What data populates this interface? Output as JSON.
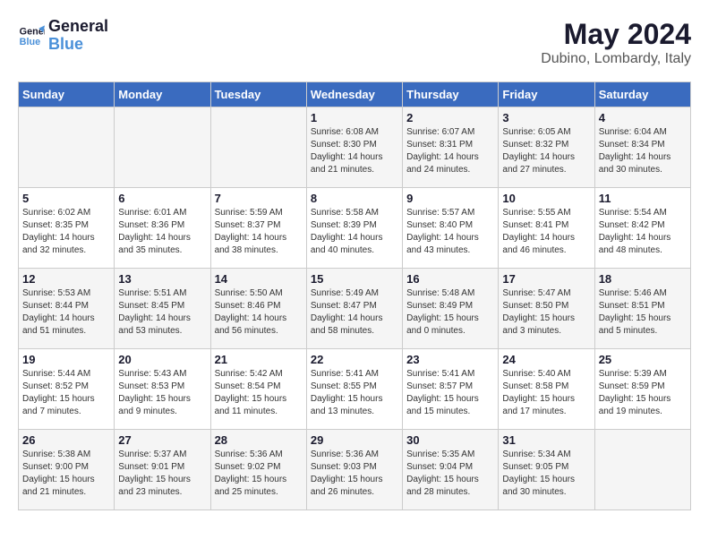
{
  "header": {
    "logo_line1": "General",
    "logo_line2": "Blue",
    "month_year": "May 2024",
    "location": "Dubino, Lombardy, Italy"
  },
  "days_of_week": [
    "Sunday",
    "Monday",
    "Tuesday",
    "Wednesday",
    "Thursday",
    "Friday",
    "Saturday"
  ],
  "weeks": [
    [
      {
        "day": "",
        "detail": ""
      },
      {
        "day": "",
        "detail": ""
      },
      {
        "day": "",
        "detail": ""
      },
      {
        "day": "1",
        "detail": "Sunrise: 6:08 AM\nSunset: 8:30 PM\nDaylight: 14 hours\nand 21 minutes."
      },
      {
        "day": "2",
        "detail": "Sunrise: 6:07 AM\nSunset: 8:31 PM\nDaylight: 14 hours\nand 24 minutes."
      },
      {
        "day": "3",
        "detail": "Sunrise: 6:05 AM\nSunset: 8:32 PM\nDaylight: 14 hours\nand 27 minutes."
      },
      {
        "day": "4",
        "detail": "Sunrise: 6:04 AM\nSunset: 8:34 PM\nDaylight: 14 hours\nand 30 minutes."
      }
    ],
    [
      {
        "day": "5",
        "detail": "Sunrise: 6:02 AM\nSunset: 8:35 PM\nDaylight: 14 hours\nand 32 minutes."
      },
      {
        "day": "6",
        "detail": "Sunrise: 6:01 AM\nSunset: 8:36 PM\nDaylight: 14 hours\nand 35 minutes."
      },
      {
        "day": "7",
        "detail": "Sunrise: 5:59 AM\nSunset: 8:37 PM\nDaylight: 14 hours\nand 38 minutes."
      },
      {
        "day": "8",
        "detail": "Sunrise: 5:58 AM\nSunset: 8:39 PM\nDaylight: 14 hours\nand 40 minutes."
      },
      {
        "day": "9",
        "detail": "Sunrise: 5:57 AM\nSunset: 8:40 PM\nDaylight: 14 hours\nand 43 minutes."
      },
      {
        "day": "10",
        "detail": "Sunrise: 5:55 AM\nSunset: 8:41 PM\nDaylight: 14 hours\nand 46 minutes."
      },
      {
        "day": "11",
        "detail": "Sunrise: 5:54 AM\nSunset: 8:42 PM\nDaylight: 14 hours\nand 48 minutes."
      }
    ],
    [
      {
        "day": "12",
        "detail": "Sunrise: 5:53 AM\nSunset: 8:44 PM\nDaylight: 14 hours\nand 51 minutes."
      },
      {
        "day": "13",
        "detail": "Sunrise: 5:51 AM\nSunset: 8:45 PM\nDaylight: 14 hours\nand 53 minutes."
      },
      {
        "day": "14",
        "detail": "Sunrise: 5:50 AM\nSunset: 8:46 PM\nDaylight: 14 hours\nand 56 minutes."
      },
      {
        "day": "15",
        "detail": "Sunrise: 5:49 AM\nSunset: 8:47 PM\nDaylight: 14 hours\nand 58 minutes."
      },
      {
        "day": "16",
        "detail": "Sunrise: 5:48 AM\nSunset: 8:49 PM\nDaylight: 15 hours\nand 0 minutes."
      },
      {
        "day": "17",
        "detail": "Sunrise: 5:47 AM\nSunset: 8:50 PM\nDaylight: 15 hours\nand 3 minutes."
      },
      {
        "day": "18",
        "detail": "Sunrise: 5:46 AM\nSunset: 8:51 PM\nDaylight: 15 hours\nand 5 minutes."
      }
    ],
    [
      {
        "day": "19",
        "detail": "Sunrise: 5:44 AM\nSunset: 8:52 PM\nDaylight: 15 hours\nand 7 minutes."
      },
      {
        "day": "20",
        "detail": "Sunrise: 5:43 AM\nSunset: 8:53 PM\nDaylight: 15 hours\nand 9 minutes."
      },
      {
        "day": "21",
        "detail": "Sunrise: 5:42 AM\nSunset: 8:54 PM\nDaylight: 15 hours\nand 11 minutes."
      },
      {
        "day": "22",
        "detail": "Sunrise: 5:41 AM\nSunset: 8:55 PM\nDaylight: 15 hours\nand 13 minutes."
      },
      {
        "day": "23",
        "detail": "Sunrise: 5:41 AM\nSunset: 8:57 PM\nDaylight: 15 hours\nand 15 minutes."
      },
      {
        "day": "24",
        "detail": "Sunrise: 5:40 AM\nSunset: 8:58 PM\nDaylight: 15 hours\nand 17 minutes."
      },
      {
        "day": "25",
        "detail": "Sunrise: 5:39 AM\nSunset: 8:59 PM\nDaylight: 15 hours\nand 19 minutes."
      }
    ],
    [
      {
        "day": "26",
        "detail": "Sunrise: 5:38 AM\nSunset: 9:00 PM\nDaylight: 15 hours\nand 21 minutes."
      },
      {
        "day": "27",
        "detail": "Sunrise: 5:37 AM\nSunset: 9:01 PM\nDaylight: 15 hours\nand 23 minutes."
      },
      {
        "day": "28",
        "detail": "Sunrise: 5:36 AM\nSunset: 9:02 PM\nDaylight: 15 hours\nand 25 minutes."
      },
      {
        "day": "29",
        "detail": "Sunrise: 5:36 AM\nSunset: 9:03 PM\nDaylight: 15 hours\nand 26 minutes."
      },
      {
        "day": "30",
        "detail": "Sunrise: 5:35 AM\nSunset: 9:04 PM\nDaylight: 15 hours\nand 28 minutes."
      },
      {
        "day": "31",
        "detail": "Sunrise: 5:34 AM\nSunset: 9:05 PM\nDaylight: 15 hours\nand 30 minutes."
      },
      {
        "day": "",
        "detail": ""
      }
    ]
  ]
}
